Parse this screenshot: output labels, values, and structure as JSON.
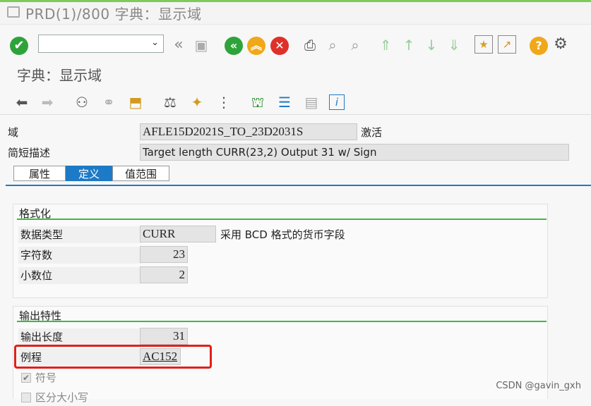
{
  "window": {
    "title": "PRD(1)/800 字典：显示域"
  },
  "toolbar": {
    "command_placeholder": "",
    "dropdown_icon": "chevron-down-icon"
  },
  "screen": {
    "subtitle": "字典：显示域"
  },
  "header": {
    "domain_label": "域",
    "domain_value": "AFLE15D2021S_TO_23D2031S",
    "domain_status": "激活",
    "short_desc_label": "简短描述",
    "short_desc_value": "Target length CURR(23,2) Output 31 w/ Sign"
  },
  "tabs": [
    {
      "label": "属性",
      "active": false
    },
    {
      "label": "定义",
      "active": true
    },
    {
      "label": "值范围",
      "active": false
    }
  ],
  "format_group": {
    "title": "格式化",
    "data_type_label": "数据类型",
    "data_type_value": "CURR",
    "data_type_desc": "采用 BCD 格式的货币字段",
    "num_chars_label": "字符数",
    "num_chars_value": "23",
    "decimals_label": "小数位",
    "decimals_value": "2"
  },
  "output_group": {
    "title": "输出特性",
    "output_len_label": "输出长度",
    "output_len_value": "31",
    "routine_label": "例程",
    "routine_value": "AC152",
    "sign_label": "符号",
    "sign_checked": true,
    "lowercase_label": "区分大小写",
    "lowercase_checked": false
  },
  "watermark": "CSDN @gavin_gxh",
  "colors": {
    "accent": "#1d7ac6",
    "ok_green": "#2fa33b",
    "highlight_red": "#e0201a",
    "group_line": "#40b840"
  }
}
